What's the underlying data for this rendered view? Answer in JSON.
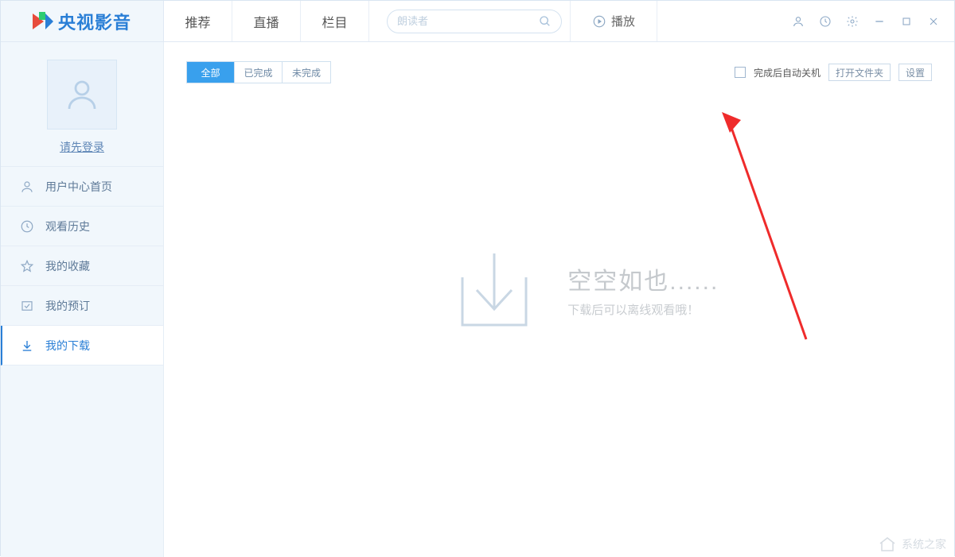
{
  "app": {
    "title": "央视影音"
  },
  "nav": {
    "tabs": [
      "推荐",
      "直播",
      "栏目"
    ]
  },
  "search": {
    "placeholder": "朗读者"
  },
  "play_button": {
    "label": "播放"
  },
  "sidebar": {
    "login_prompt": "请先登录",
    "items": [
      {
        "label": "用户中心首页",
        "icon": "user"
      },
      {
        "label": "观看历史",
        "icon": "history"
      },
      {
        "label": "我的收藏",
        "icon": "star"
      },
      {
        "label": "我的预订",
        "icon": "check"
      },
      {
        "label": "我的下载",
        "icon": "download"
      }
    ]
  },
  "toolbar": {
    "segments": [
      "全部",
      "已完成",
      "未完成"
    ],
    "shutdown_label": "完成后自动关机",
    "open_folder": "打开文件夹",
    "settings": "设置"
  },
  "empty_state": {
    "title": "空空如也......",
    "subtitle": "下载后可以离线观看哦！"
  },
  "watermark": {
    "text": "系统之家"
  }
}
